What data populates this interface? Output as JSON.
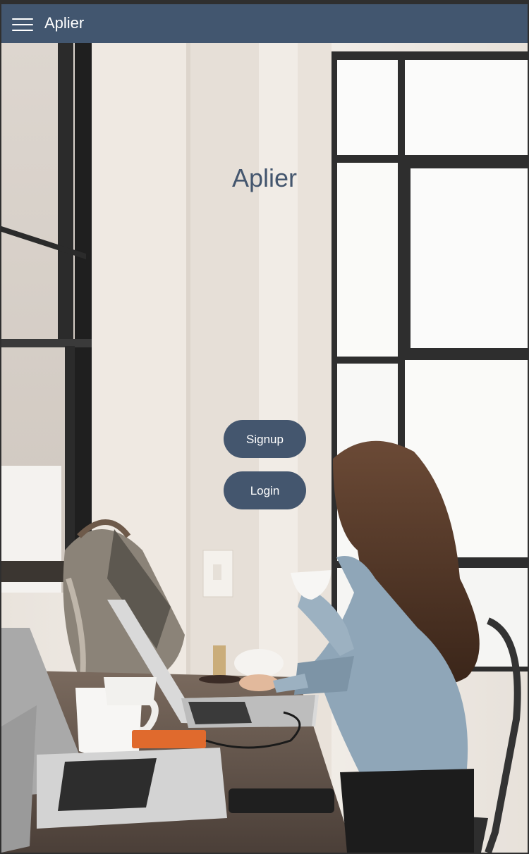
{
  "navbar": {
    "menu_icon": "hamburger-icon",
    "title": "Aplier"
  },
  "hero": {
    "title": "Aplier",
    "background": "photo-woman-laptop-cafe"
  },
  "buttons": {
    "signup_label": "Signup",
    "login_label": "Login"
  },
  "colors": {
    "brand": "#42566f",
    "button": "#44566e",
    "button_text": "#ffffff"
  }
}
